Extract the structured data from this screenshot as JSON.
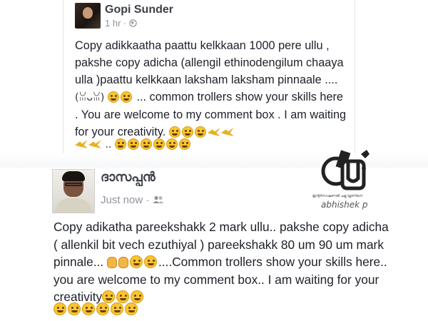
{
  "top_post": {
    "author": "Gopi Sunder",
    "timestamp": "1 hr",
    "privacy_icon": "globe-icon",
    "text": "Copy adikkaatha paattu kelkkaan 1000 pere ullu , pakshe copy adicha (allengil ethinodengilum chaaya ulla )paattu kelkkaan laksham laksham pinnaale ....",
    "text_tail": "... common trollers show your skills here . You are welcome to my comment box . I am waiting for your creativity."
  },
  "bottom_post": {
    "author": "ദാസപ്പൻ",
    "timestamp": "Just now",
    "audience_icon": "friends-icon",
    "text": "Copy adikatha pareekshakk 2 mark ullu.. pakshe copy adicha ( allenkil bit vech ezuthiyal ) pareekshakk 80 um 90 um mark pinnale...",
    "text_tail": "....Common trollers show your skills here.. you are welcome to my comment box.. I am waiting for your creativity"
  },
  "watermark": {
    "logo_text": "ICU",
    "caption": "ഇന്റർനാഷണൽ ചളു യൂണിയൻ",
    "credit": "abhishek p"
  },
  "colors": {
    "name": "#3b3f46",
    "meta": "#90949c",
    "body_text": "#1d2129",
    "emoji": "#f7c631"
  }
}
